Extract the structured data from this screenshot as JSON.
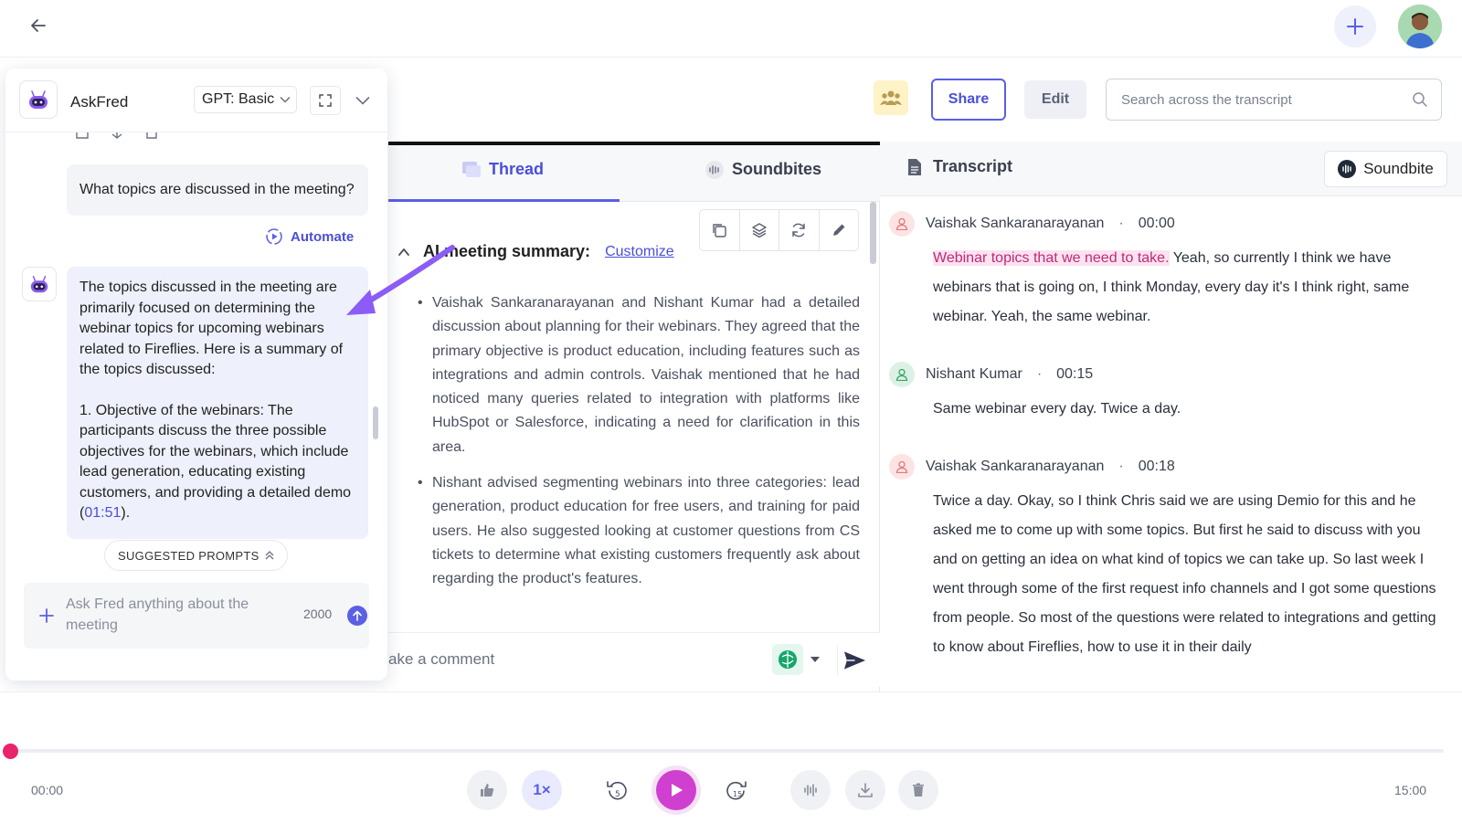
{
  "top": {
    "back_icon": "arrow-left-icon",
    "plus_icon": "plus-icon"
  },
  "toolbar": {
    "share_label": "Share",
    "edit_label": "Edit",
    "search_placeholder": "Search across the transcript"
  },
  "askfred": {
    "title": "AskFred",
    "model": "GPT: Basic",
    "user_message": "What topics are discussed in the meeting?",
    "automate_label": "Automate",
    "bot_message_intro": "The topics discussed in the meeting are primarily focused on determining the webinar topics for upcoming webinars related to Fireflies. Here is a summary of the topics discussed:",
    "bot_message_item": "1. Objective of the webinars: The participants discuss the three possible objectives for the webinars, which include lead generation, educating existing customers, and providing a detailed demo (",
    "bot_message_timestamp": "01:51",
    "bot_message_end": ").",
    "suggested_prompts_label": "SUGGESTED PROMPTS",
    "ask_placeholder": "Ask Fred anything about the meeting",
    "char_count": "2000"
  },
  "middle": {
    "tabs": [
      {
        "label": "Thread",
        "active": true
      },
      {
        "label": "Soundbites",
        "active": false
      }
    ],
    "summary_title": "AI meeting summary:",
    "customize_label": "Customize",
    "summary_bullets": [
      "Vaishak Sankaranarayanan and Nishant Kumar had a detailed discussion about planning for their webinars. They agreed that the primary objective is product education, including features such as integrations and admin controls. Vaishak mentioned that he had noticed many queries related to integration with platforms like HubSpot or Salesforce, indicating a need for clarification in this area.",
      "Nishant advised segmenting webinars into three categories: lead generation, product education for free users, and training for paid users. He also suggested looking at customer questions from CS tickets to determine what existing customers frequently ask about regarding the product's features."
    ],
    "comment_placeholder": "ake a comment"
  },
  "transcript": {
    "title": "Transcript",
    "soundbite_label": "Soundbite",
    "turns": [
      {
        "speaker": "Vaishak Sankaranarayanan",
        "time": "00:00",
        "highlight": "Webinar topics that we need to take.",
        "text": " Yeah, so currently I think we have webinars that is going on, I think Monday, every day it's I think right, same webinar. Yeah, the same webinar."
      },
      {
        "speaker": "Nishant Kumar",
        "time": "00:15",
        "highlight": "",
        "text": "Same webinar every day. Twice a day."
      },
      {
        "speaker": "Vaishak Sankaranarayanan",
        "time": "00:18",
        "highlight": "",
        "text": "Twice a day. Okay, so I think Chris said we are using Demio for this and he asked me to come up with some topics. But first he said to discuss with you and on getting an idea on what kind of topics we can take up. So last week I went through some of the first request info channels and I got some questions from people. So most of the questions were related to integrations and getting to know about Fireflies, how to use it in their daily"
      }
    ]
  },
  "player": {
    "time_start": "00:00",
    "time_end": "15:00",
    "speed": "1×",
    "progress": 0.0
  },
  "colors": {
    "accent": "#5a5fe4",
    "play": "#cf3fd0",
    "progress_knob": "#e8246b",
    "highlight_text": "#c0287a"
  }
}
